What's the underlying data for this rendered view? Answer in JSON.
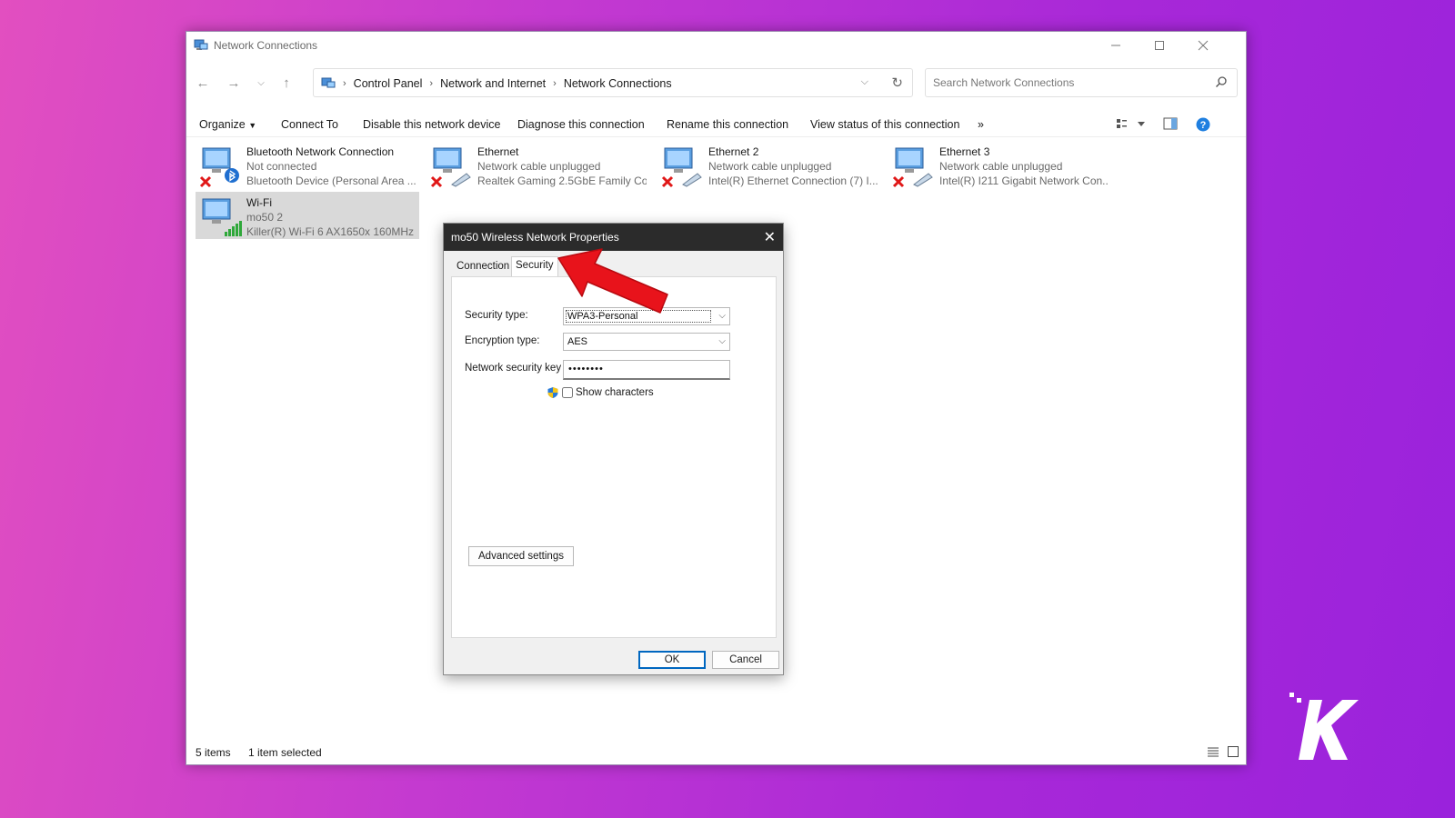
{
  "window": {
    "title": "Network Connections"
  },
  "address": {
    "crumbs": [
      "Control Panel",
      "Network and Internet",
      "Network Connections"
    ]
  },
  "search": {
    "placeholder": "Search Network Connections"
  },
  "toolbar": {
    "organize": "Organize",
    "connect_to": "Connect To",
    "disable": "Disable this network device",
    "diagnose": "Diagnose this connection",
    "rename": "Rename this connection",
    "view_status": "View status of this connection",
    "more": "»"
  },
  "connections": [
    {
      "name": "Bluetooth Network Connection",
      "status": "Not connected",
      "device": "Bluetooth Device (Personal Area ...",
      "badge": "bluetooth-icon",
      "disconnected": true
    },
    {
      "name": "Ethernet",
      "status": "Network cable unplugged",
      "device": "Realtek Gaming 2.5GbE Family Co...",
      "badge": "ethernet-cable-icon",
      "disconnected": true
    },
    {
      "name": "Ethernet 2",
      "status": "Network cable unplugged",
      "device": "Intel(R) Ethernet Connection (7) I...",
      "badge": "ethernet-cable-icon",
      "disconnected": true
    },
    {
      "name": "Ethernet 3",
      "status": "Network cable unplugged",
      "device": "Intel(R) I211 Gigabit Network Con...",
      "badge": "ethernet-cable-icon",
      "disconnected": true
    },
    {
      "name": "Wi-Fi",
      "status": "mo50 2",
      "device": "Killer(R) Wi-Fi 6 AX1650x 160MHz ...",
      "badge": "wifi-signal-icon",
      "disconnected": false,
      "selected": true
    }
  ],
  "status": {
    "count": "5 items",
    "selection": "1 item selected"
  },
  "dialog": {
    "title": "mo50 Wireless Network Properties",
    "tabs": [
      "Connection",
      "Security"
    ],
    "active_tab": "Security",
    "security_type_label": "Security type:",
    "security_type_value": "WPA3-Personal",
    "encryption_type_label": "Encryption type:",
    "encryption_type_value": "AES",
    "key_label": "Network security key",
    "key_value": "••••••••",
    "show_characters": "Show characters",
    "advanced": "Advanced settings",
    "ok": "OK",
    "cancel": "Cancel"
  },
  "colors": {
    "accent": "#0067c0",
    "dialog_title_bg": "#2b2b2b",
    "arrow": "#e8131b"
  }
}
